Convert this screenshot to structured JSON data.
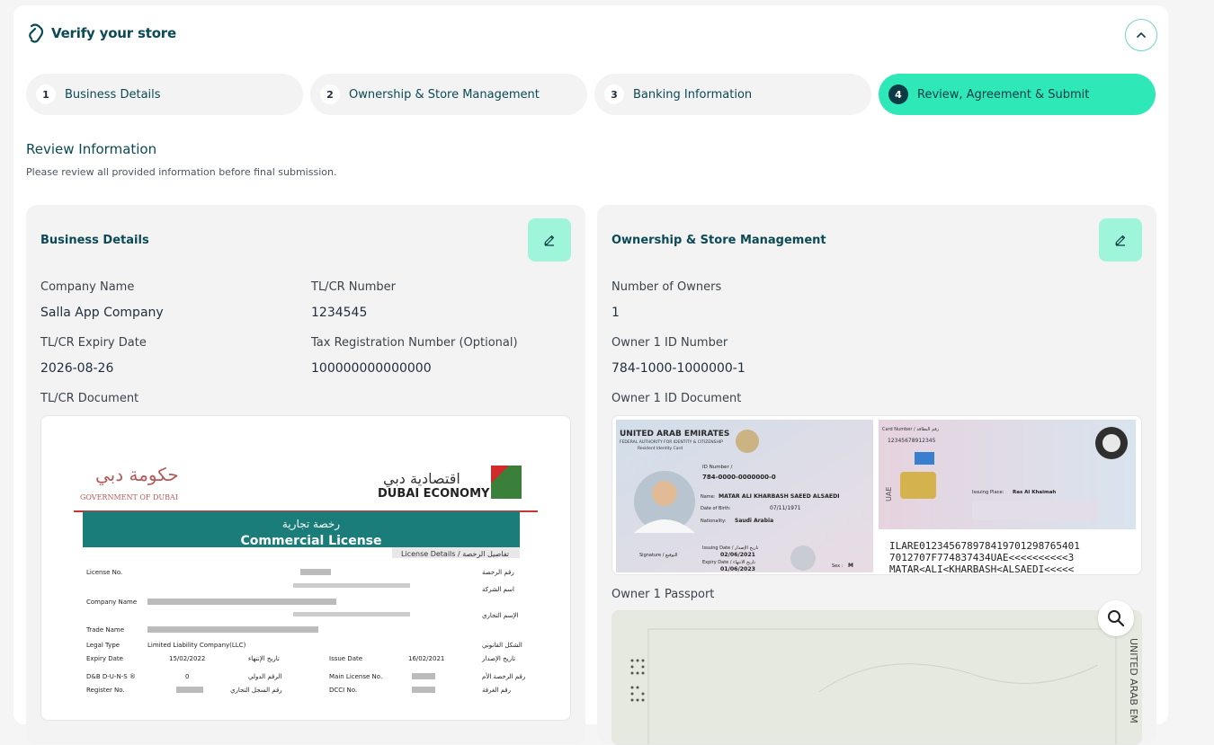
{
  "header": {
    "title": "Verify your store"
  },
  "steps": [
    {
      "num": "1",
      "label": "Business Details"
    },
    {
      "num": "2",
      "label": "Ownership & Store Management"
    },
    {
      "num": "3",
      "label": "Banking Information"
    },
    {
      "num": "4",
      "label": "Review, Agreement & Submit"
    }
  ],
  "review": {
    "title": "Review Information",
    "subtitle": "Please review all provided information before final submission."
  },
  "business": {
    "title": "Business Details",
    "company_name_label": "Company Name",
    "company_name_value": "Salla App Company",
    "tl_number_label": "TL/CR Number",
    "tl_number_value": "1234545",
    "expiry_label": "TL/CR Expiry Date",
    "expiry_value": "2026-08-26",
    "trn_label": "Tax Registration Number (Optional)",
    "trn_value": "100000000000000",
    "doc_label": "TL/CR Document",
    "license": {
      "gov_ar": "حكومة دبي",
      "gov_en": "GOVERNMENT OF DUBAI",
      "economy_ar": "اقتصادية دبي",
      "economy_en": "DUBAI ECONOMY",
      "banner_ar": "رخصة تجارية",
      "banner_en": "Commercial License",
      "details_label": "License Details /  تفاصيل الرخصة",
      "row_license_no": "License No.",
      "row_license_no_ar": "رقم الرخصة",
      "row_company_name": "Company Name",
      "row_company_name_ar": "اسم الشركة",
      "row_trade_name": "Trade Name",
      "row_trade_name_ar": "الإسم التجاري",
      "row_legal_type": "Legal Type",
      "row_legal_type_value": "Limited Liability Company(LLC)",
      "row_legal_type_ar": "الشكل القانوني",
      "row_expiry": "Expiry Date",
      "row_expiry_value": "15/02/2022",
      "row_expiry_ar": "تاريخ الإنتهاء",
      "row_issue": "Issue Date",
      "row_issue_value": "16/02/2021",
      "row_issue_ar": "تاريخ الإصدار",
      "row_duns": "D&B D-U-N-S ®",
      "row_duns_value": "0",
      "row_duns_ar": "الرقم الدولي",
      "row_main": "Main License No.",
      "row_main_ar": "رقم الرخصة الأم",
      "row_register": "Register No.",
      "row_register_ar": "رقم السجل التجاري",
      "row_dcci": "DCCI No.",
      "row_dcci_ar": "رقم الغرفة"
    }
  },
  "ownership": {
    "title": "Ownership & Store Management",
    "owners_label": "Number of Owners",
    "owners_value": "1",
    "id_label": "Owner 1 ID Number",
    "id_value": "784-1000-1000000-1",
    "id_doc_label": "Owner 1 ID Document",
    "passport_label": "Owner 1 Passport",
    "id_card": {
      "country": "UNITED ARAB EMIRATES",
      "authority": "FEDERAL AUTHORITY FOR IDENTITY & CITIZENSHIP",
      "card_type": "Resident Identity Card",
      "id_number_label": "ID Number /",
      "id_number": "784-0000-0000000-0",
      "name_label": "Name:",
      "name": "MATAR ALI KHARBASH SAEED ALSAEDI",
      "dob_label": "Date of Birth:",
      "dob": "07/11/1971",
      "nationality_label": "Nationality:",
      "nationality": "Saudi Arabia",
      "signature_label": "Signature / التوقيع",
      "issuing_label": "Issuing Date / تاريخ الإصدار",
      "issuing": "02/06/2021",
      "expiry_label": "Expiry Date / تاريخ الانتهاء",
      "expiry": "01/06/2023",
      "sex_label": "Sex :",
      "sex": "M",
      "card_number_label": "Card Number / رقم البطاقة",
      "card_number": "12345678912345",
      "issuing_place_label": "Issuing Place:",
      "issuing_place": "Ras Al Khaimah",
      "uae": "UAE",
      "mrz1": "ILARE012345678978419701298765401",
      "mrz2": "7012707F774837434UAE<<<<<<<<<<3",
      "mrz3": "MATAR<ALI<KHARBASH<ALSAEDI<<<<<"
    },
    "passport": {
      "side_text": "UNITED ARAB EM"
    }
  },
  "colors": {
    "accent": "#2ee8b8",
    "dark": "#0b3b45",
    "edit_bg": "#9ff5d9"
  }
}
